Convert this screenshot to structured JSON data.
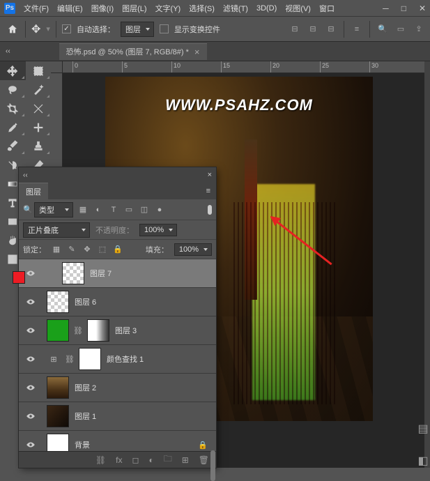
{
  "menu": {
    "items": [
      "文件(F)",
      "编辑(E)",
      "图像(I)",
      "图层(L)",
      "文字(Y)",
      "选择(S)",
      "滤镜(T)",
      "3D(D)",
      "视图(V)",
      "窗口"
    ]
  },
  "optbar": {
    "auto_select": "自动选择：",
    "layer": "图层",
    "show_transform": "显示变换控件"
  },
  "doctab": {
    "title": "恐怖.psd @ 50% (图层 7, RGB/8#) *"
  },
  "ruler": {
    "ticks": [
      "0",
      "5",
      "10",
      "15",
      "20",
      "25",
      "30"
    ]
  },
  "canvas": {
    "watermark": "WWW.PSAHZ.COM"
  },
  "layers_panel": {
    "tab": "图层",
    "filter_label": "类型",
    "blend_mode": "正片叠底",
    "opacity_label": "不透明度：",
    "opacity_value": "100%",
    "lock_label": "锁定：",
    "fill_label": "填充：",
    "fill_value": "100%",
    "layers": [
      {
        "name": "图层 7"
      },
      {
        "name": "图层 6"
      },
      {
        "name": "图层 3"
      },
      {
        "name": "颜色查找 1"
      },
      {
        "name": "图层 2"
      },
      {
        "name": "图层 1"
      },
      {
        "name": "背景"
      }
    ]
  }
}
